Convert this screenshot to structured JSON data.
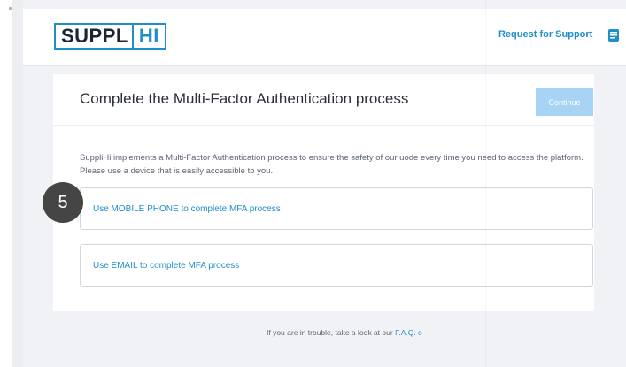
{
  "header": {
    "logo_part1": "SUPPL",
    "logo_part2": "HI",
    "support_link": "Request for Support",
    "support_icon": "book-icon"
  },
  "card": {
    "title": "Complete the Multi-Factor Authentication process",
    "continue_label": "Continue",
    "description": "SuppliHi implements a Multi-Factor Authentication process to ensure the safety of our uode every time you need to access the platform. Please use a device that is easily accessible to you.",
    "options": [
      {
        "label": "Use MOBILE PHONE to complete MFA process"
      },
      {
        "label": "Use EMAIL to complete MFA process"
      }
    ]
  },
  "footer": {
    "text": "If you are in trouble, take a look at our",
    "faq_link": "F.A.Q. o"
  },
  "badge": {
    "step": "5"
  },
  "colors": {
    "accent": "#1f8ec9",
    "continue_disabled": "#a7d3f5",
    "page_bg": "#f1f2f5",
    "badge_bg": "#454545"
  }
}
